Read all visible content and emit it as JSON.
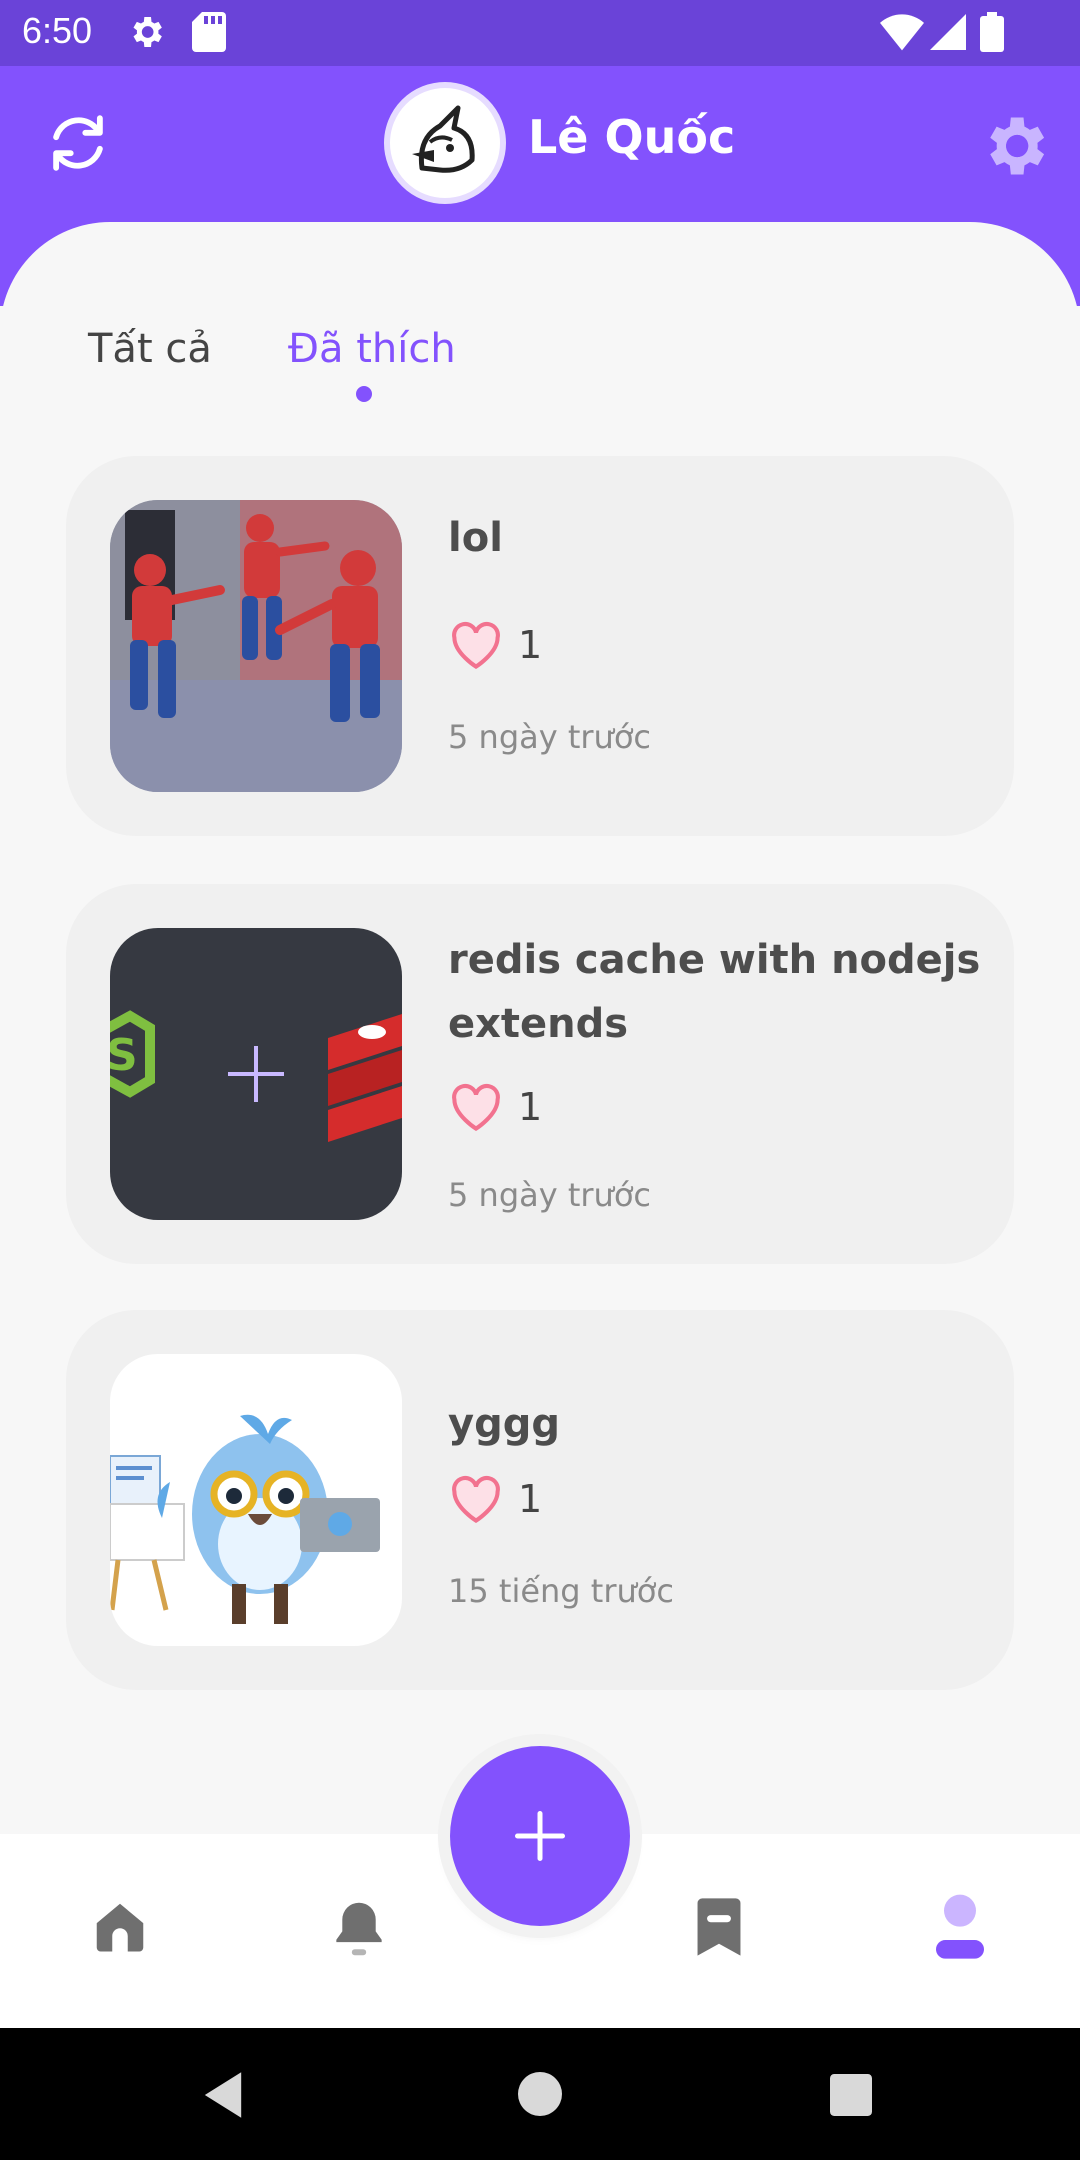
{
  "status_bar": {
    "time": "6:50",
    "icons": [
      "settings-icon",
      "sd-card-icon",
      "wifi-icon",
      "signal-icon",
      "battery-icon"
    ]
  },
  "header": {
    "user_name": "Lê Quốc",
    "refresh_icon": "refresh-icon",
    "settings_icon": "gear-icon",
    "avatar_icon": "unicorn-avatar"
  },
  "tabs": [
    {
      "label": "Tất cả",
      "active": false
    },
    {
      "label": "Đã thích",
      "active": true
    }
  ],
  "posts": [
    {
      "title": "lol",
      "likes": "1",
      "time": "5 ngày trước",
      "thumbnail": "spiderman-pointing-meme"
    },
    {
      "title": "redis cache with nodejs extends",
      "likes": "1",
      "time": "5 ngày trước",
      "thumbnail": "nodejs-plus-redis"
    },
    {
      "title": "yggg",
      "likes": "1",
      "time": "15 tiếng trước",
      "thumbnail": "flutter-dash-bird"
    }
  ],
  "bottom_nav": {
    "items": [
      "home-icon",
      "bell-icon",
      "add-button",
      "bookmark-icon",
      "profile-icon"
    ],
    "active": "profile-icon"
  },
  "colors": {
    "primary": "#8352fd",
    "status_bar": "#6a43d8",
    "heart": "#f2728f"
  }
}
